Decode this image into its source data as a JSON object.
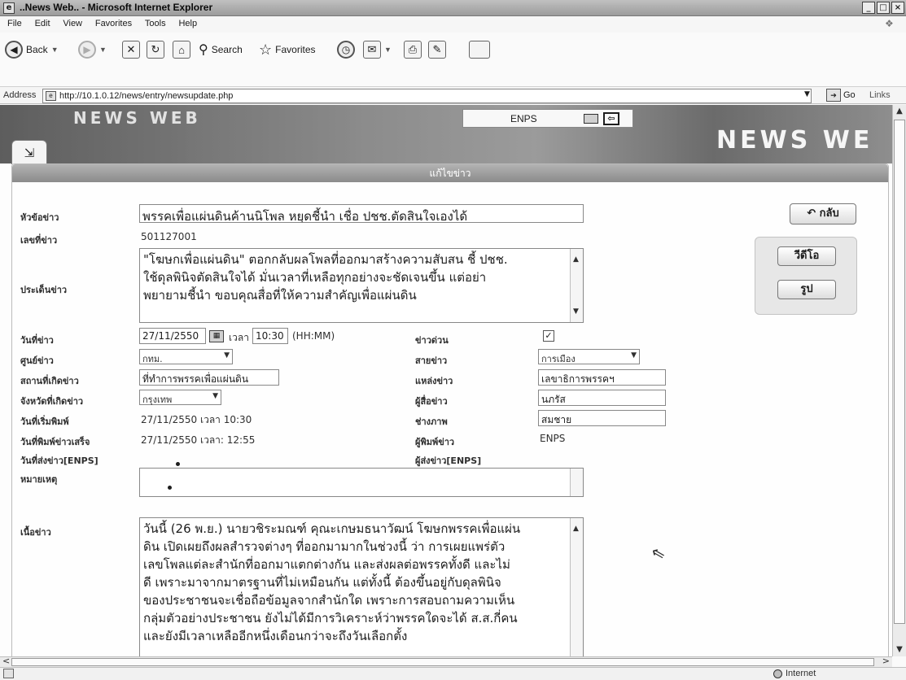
{
  "window": {
    "title": "..News Web.. - Microsoft Internet Explorer",
    "controls": [
      "_",
      "□",
      "×"
    ]
  },
  "menu": [
    "File",
    "Edit",
    "View",
    "Favorites",
    "Tools",
    "Help"
  ],
  "toolbar": {
    "back": "Back",
    "search": "Search",
    "favorites": "Favorites"
  },
  "address": {
    "label": "Address",
    "url": "http://10.1.0.12/news/entry/newsupdate.php",
    "go": "Go",
    "links": "Links"
  },
  "status": {
    "zone": "Internet"
  },
  "app": {
    "logo": "NEWS WEB",
    "logo_big": "NEWS WE",
    "system": "ENPS",
    "panel_title": "แก้ไขข่าว"
  },
  "form": {
    "headline_label": "หัวข้อข่าว",
    "headline": "พรรคเพื่อแผ่นดินค้านนิโพล หยุดชี้นำ เชื่อ ปชช.ตัดสินใจเองได้",
    "news_no_label": "เลขที่ข่าว",
    "news_no": "501127001",
    "issue_label": "ประเด็นข่าว",
    "issue_lines": [
      "\"โฆษกเพื่อแผ่นดิน\" ตอกกลับผลโพลที่ออกมาสร้างความสับสน ชี้ ปชช.",
      "ใช้ดุลพินิจตัดสินใจได้ มั่นเวลาที่เหลือทุกอย่างจะชัดเจนขึ้น แต่อย่า",
      "พยายามชี้นำ ขอบคุณสื่อที่ให้ความสำคัญเพื่อแผ่นดิน"
    ],
    "date_label": "วันที่ข่าว",
    "date": "27/11/2550",
    "time_label": "เวลา",
    "time": "10:30",
    "time_format": "(HH:MM)",
    "urgent_label": "ข่าวด่วน",
    "urgent_checked": "✓",
    "center_label": "ศูนย์ข่าว",
    "center": "กทม.",
    "line_label": "สายข่าว",
    "line": "การเมือง",
    "place_label": "สถานที่เกิดข่าว",
    "place": "ที่ทำการพรรคเพื่อแผ่นดิน",
    "source_label": "แหล่งข่าว",
    "source": "เลขาธิการพรรคฯ",
    "province_label": "จังหวัดที่เกิดข่าว",
    "province": "กรุงเทพ",
    "reporter_label": "ผู้สื่อข่าว",
    "reporter": "นภรัส",
    "start_label": "วันที่เริ่มพิมพ์",
    "start": "27/11/2550 เวลา 10:30",
    "photographer_label": "ช่างภาพ",
    "photographer": "สมชาย",
    "finish_label": "วันที่พิมพ์ข่าวเสร็จ",
    "finish": "27/11/2550 เวลา: 12:55",
    "typist_label": "ผู้พิมพ์ข่าว",
    "typist": "ENPS",
    "sent_label": "วันที่ส่งข่าว[ENPS]",
    "sender_label": "ผู้ส่งข่าว[ENPS]",
    "note_label": "หมายเหตุ",
    "body_label": "เนื้อข่าว",
    "body_lines": [
      "วันนี้ (26 พ.ย.) นายวชิระมณฑ์ คุณะเกษมธนาวัฒน์ โฆษกพรรคเพื่อแผ่น",
      "ดิน เปิดเผยถึงผลสำรวจต่างๆ ที่ออกมามากในช่วงนี้ ว่า การเผยแพร่ตัว",
      "เลขโพลแต่ละสำนักที่ออกมาแตกต่างกัน และส่งผลต่อพรรคทั้งดี และไม่",
      "ดี เพราะมาจากมาตรฐานที่ไม่เหมือนกัน แต่ทั้งนี้ ต้องขึ้นอยู่กับดุลพินิจ",
      "ของประชาชนจะเชื่อถือข้อมูลจากสำนักใด เพราะการสอบถามความเห็น",
      "กลุ่มตัวอย่างประชาชน ยังไม่ได้มีการวิเคราะห์ว่าพรรคใดจะได้ ส.ส.กี่คน",
      "และยังมีเวลาเหลืออีกหนึ่งเดือนกว่าจะถึงวันเลือกตั้ง"
    ]
  },
  "buttons": {
    "back": "กลับ",
    "video": "วีดีโอ",
    "photo": "รูป"
  }
}
